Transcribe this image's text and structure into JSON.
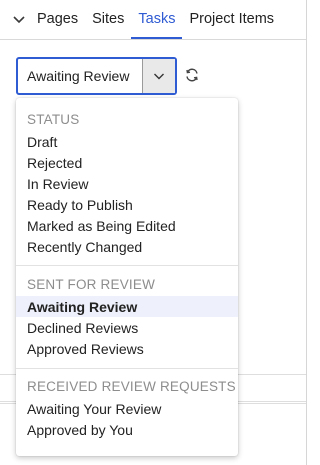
{
  "tabs": [
    {
      "label": "Pages",
      "active": false
    },
    {
      "label": "Sites",
      "active": false
    },
    {
      "label": "Tasks",
      "active": true
    },
    {
      "label": "Project Items",
      "active": false
    }
  ],
  "filter": {
    "selected": "Awaiting Review",
    "toggle_icon": "chevron-down-icon",
    "refresh_icon": "refresh-icon"
  },
  "menu": {
    "groups": [
      {
        "label": "STATUS",
        "items": [
          "Draft",
          "Rejected",
          "In Review",
          "Ready to Publish",
          "Marked as Being Edited",
          "Recently Changed"
        ]
      },
      {
        "label": "SENT FOR REVIEW",
        "items": [
          "Awaiting Review",
          "Declined Reviews",
          "Approved Reviews"
        ]
      },
      {
        "label": "RECEIVED REVIEW REQUESTS",
        "items": [
          "Awaiting Your Review",
          "Approved by You"
        ]
      }
    ],
    "selected_item": "Awaiting Review"
  },
  "colors": {
    "accent": "#2f5bd3",
    "selected_bg": "#eef0fb",
    "group_label": "#8d8d8d"
  }
}
